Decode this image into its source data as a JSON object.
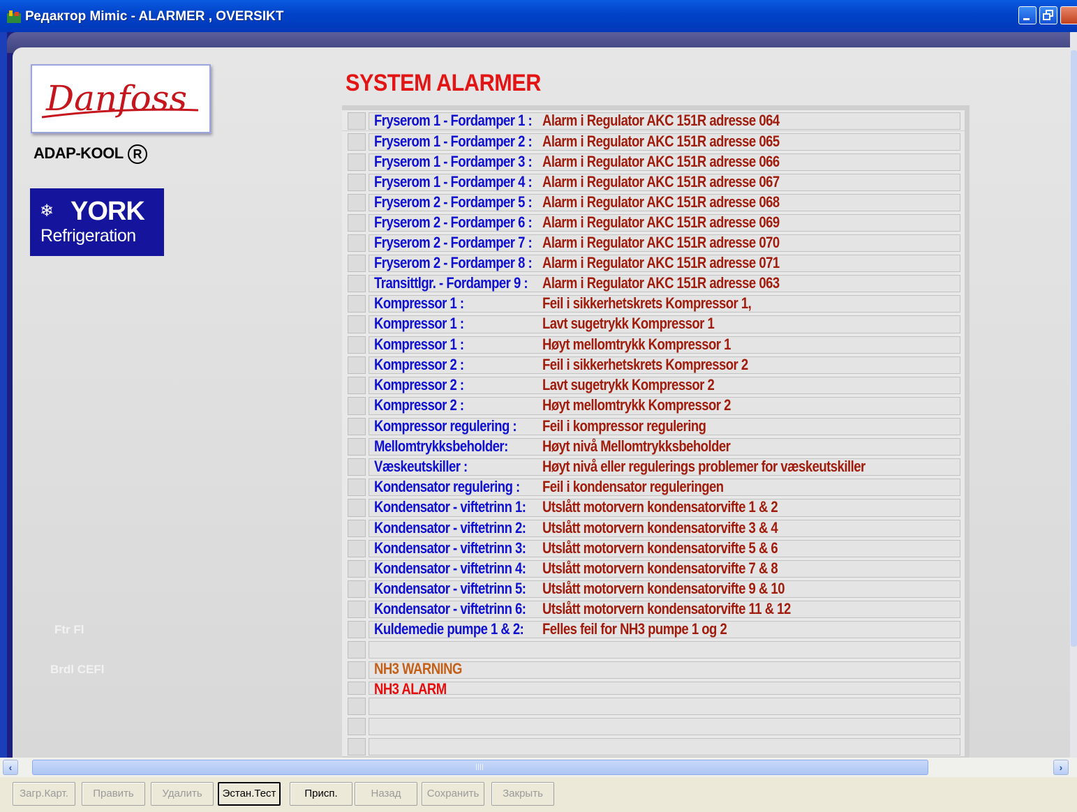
{
  "window": {
    "title": "Редактор Mimic - ALARMER , OVERSIKT"
  },
  "logos": {
    "danfoss_text": "Danfoss",
    "adap_kool": "ADAP-KOOL",
    "registered_mark": "R",
    "york_name": "YORK",
    "york_sub": "Refrigeration"
  },
  "faint_labels": [
    "Ftr Fl",
    "Brdl CEFl"
  ],
  "colors": {
    "module_label": "#1010d0",
    "alarm_text": "#a01c0c",
    "warning": "#c46018",
    "alarm": "#e80c0c",
    "title": "#e31414"
  },
  "main": {
    "title": "SYSTEM ALARMER",
    "alarms": [
      {
        "label": "Fryserom 1 - Fordamper 1 :",
        "text": "Alarm i Regulator AKC 151R adresse 064"
      },
      {
        "label": "Fryserom 1 - Fordamper 2 :",
        "text": "Alarm i Regulator AKC 151R adresse 065"
      },
      {
        "label": "Fryserom 1 - Fordamper 3 :",
        "text": "Alarm i Regulator AKC 151R adresse 066"
      },
      {
        "label": "Fryserom 1 - Fordamper 4 :",
        "text": "Alarm i Regulator AKC 151R adresse 067"
      },
      {
        "label": "Fryserom 2 - Fordamper 5 :",
        "text": "Alarm i Regulator AKC 151R adresse 068"
      },
      {
        "label": "Fryserom 2 - Fordamper 6 :",
        "text": "Alarm i Regulator AKC 151R adresse 069"
      },
      {
        "label": "Fryserom 2 - Fordamper 7 :",
        "text": "Alarm i Regulator AKC 151R adresse 070"
      },
      {
        "label": "Fryserom 2 - Fordamper 8 :",
        "text": "Alarm i Regulator AKC 151R adresse 071"
      },
      {
        "label": "Transittlgr.  - Fordamper 9 :",
        "text": "Alarm i Regulator AKC 151R adresse 063"
      },
      {
        "label": "Kompressor 1  :",
        "text": "Feil i sikkerhetskrets Kompressor 1,"
      },
      {
        "label": "Kompressor 1  :",
        "text": "Lavt sugetrykk Kompressor 1"
      },
      {
        "label": "Kompressor 1  :",
        "text": "Høyt mellomtrykk Kompressor 1"
      },
      {
        "label": "Kompressor 2  :",
        "text": "Feil i sikkerhetskrets Kompressor 2"
      },
      {
        "label": "Kompressor 2  :",
        "text": "Lavt sugetrykk Kompressor 2"
      },
      {
        "label": "Kompressor 2  :",
        "text": "Høyt mellomtrykk Kompressor 2"
      },
      {
        "label": "Kompressor regulering :",
        "text": "Feil i kompressor regulering"
      },
      {
        "label": "Mellomtrykksbeholder:",
        "text": "Høyt nivå Mellomtrykksbeholder"
      },
      {
        "label": "Væskeutskiller :",
        "text": "Høyt nivå eller regulerings problemer for væskeutskiller"
      },
      {
        "label": "Kondensator regulering :",
        "text": "Feil i kondensator reguleringen"
      },
      {
        "label": "Kondensator - viftetrinn 1:",
        "text": "Utslått motorvern kondensatorvifte 1 & 2"
      },
      {
        "label": "Kondensator - viftetrinn 2:",
        "text": "Utslått motorvern kondensatorvifte 3 & 4"
      },
      {
        "label": "Kondensator - viftetrinn 3:",
        "text": "Utslått motorvern kondensatorvifte 5 & 6"
      },
      {
        "label": "Kondensator - viftetrinn 4:",
        "text": "Utslått motorvern kondensatorvifte 7 & 8"
      },
      {
        "label": "Kondensator - viftetrinn 5:",
        "text": "Utslått motorvern kondensatorvifte 9 & 10"
      },
      {
        "label": "Kondensator - viftetrinn 6:",
        "text": "Utslått motorvern kondensatorvifte 11 & 12"
      },
      {
        "label": "Kuldemedie pumpe 1 & 2:",
        "text": "Felles feil for NH3 pumpe 1 og 2"
      }
    ],
    "nh3_warning": "NH3 WARNING",
    "nh3_alarm": "NH3 ALARM"
  },
  "toolbar": {
    "buttons": [
      {
        "label": "Загр.Карт.",
        "enabled": false
      },
      {
        "label": "Править",
        "enabled": false
      },
      {
        "label": "Удалить",
        "enabled": false
      },
      {
        "label": "Эстан.Тест",
        "enabled": true
      },
      {
        "label": "Присп.",
        "enabled": true
      },
      {
        "label": "Назад",
        "enabled": false
      },
      {
        "label": "Сохранить",
        "enabled": false
      },
      {
        "label": "Закрыть",
        "enabled": false
      }
    ]
  }
}
